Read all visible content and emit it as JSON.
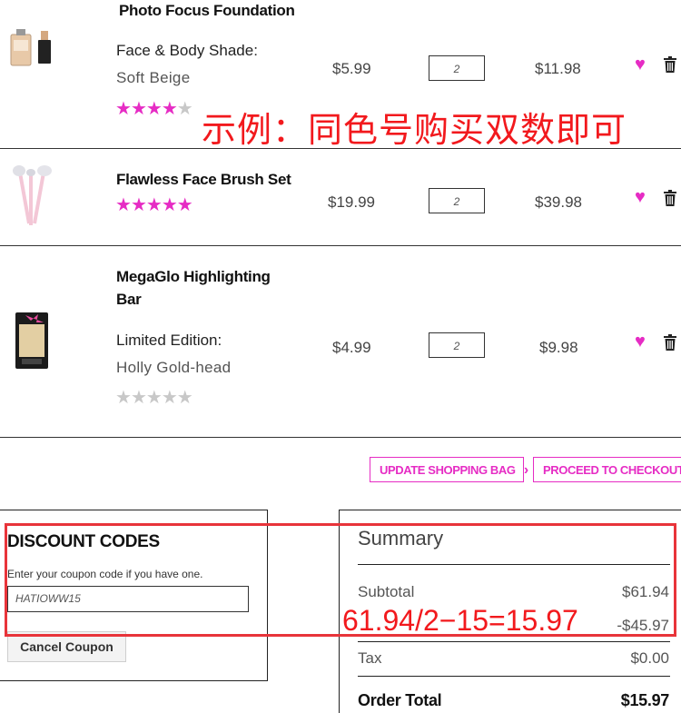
{
  "items": [
    {
      "name": "Photo Focus Foundation",
      "option_label": "Face & Body Shade:",
      "option_value": "Soft Beige",
      "price": "$5.99",
      "qty": "2",
      "total": "$11.98",
      "rating": 4.5
    },
    {
      "name": "Flawless Face Brush Set",
      "price": "$19.99",
      "qty": "2",
      "total": "$39.98",
      "rating": 5
    },
    {
      "name_line1": "MegaGlo Highlighting",
      "name_line2": "Bar",
      "option_label": "Limited Edition:",
      "option_value": "Holly Gold-head",
      "price": "$4.99",
      "qty": "2",
      "total": "$9.98",
      "rating": 0
    }
  ],
  "actions": {
    "update_bag": "UPDATE SHOPPING BAG",
    "checkout": "PROCEED TO CHECKOUT",
    "chevron": "›"
  },
  "discount": {
    "title": "DISCOUNT CODES",
    "prompt": "Enter your coupon code if you have one.",
    "code": "HATIOWW15",
    "cancel_label": "Cancel Coupon"
  },
  "summary": {
    "title": "Summary",
    "subtotal_label": "Subtotal",
    "subtotal_value": "$61.94",
    "discount_value": "-$45.97",
    "tax_label": "Tax",
    "tax_value": "$0.00",
    "total_label": "Order Total",
    "total_value": "$15.97"
  },
  "annotations": {
    "note": "示例：同色号购买双数即可",
    "formula": "61.94/2−15=15.97"
  },
  "icons": {
    "heart": "heart-icon",
    "trash": "trash-icon",
    "star": "star-icon"
  },
  "colors": {
    "accent": "#e62cc4",
    "annotation": "#f2191d"
  }
}
